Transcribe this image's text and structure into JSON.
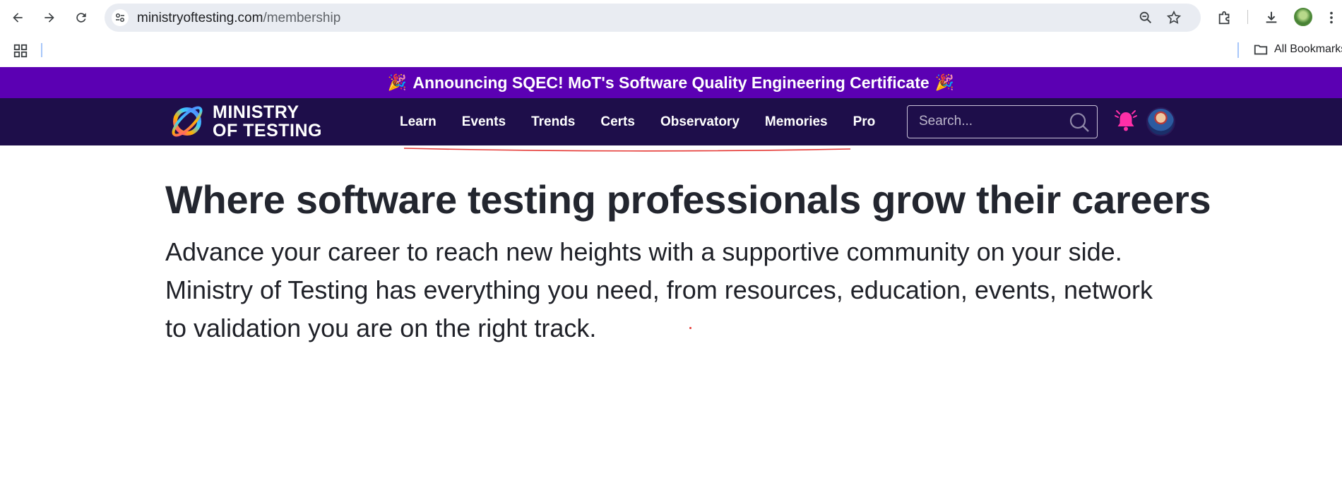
{
  "browser": {
    "url_domain": "ministryoftesting.com",
    "url_path": "/membership",
    "bookmarks_label": "All Bookmarks"
  },
  "site": {
    "announcement": "Announcing SQEC! MoT's Software Quality Engineering Certificate",
    "announcement_emoji": "🎉",
    "logo_line1": "MINISTRY",
    "logo_line2": "OF TESTING",
    "menu": [
      "Learn",
      "Events",
      "Trends",
      "Certs",
      "Observatory",
      "Memories",
      "Pro"
    ],
    "search_placeholder": "Search...",
    "colors": {
      "announcement_bg": "#5b00b3",
      "nav_bg": "#1e0e4a",
      "bell": "#ff2fa8"
    }
  },
  "hero": {
    "title": "Where software testing professionals grow their careers",
    "paragraph_line1": "Advance your career to reach new heights with a supportive community on your side.",
    "paragraph_line2": "Ministry of Testing has everything you need, from resources, education, events, network",
    "paragraph_line3": "to validation you are on the right track."
  }
}
